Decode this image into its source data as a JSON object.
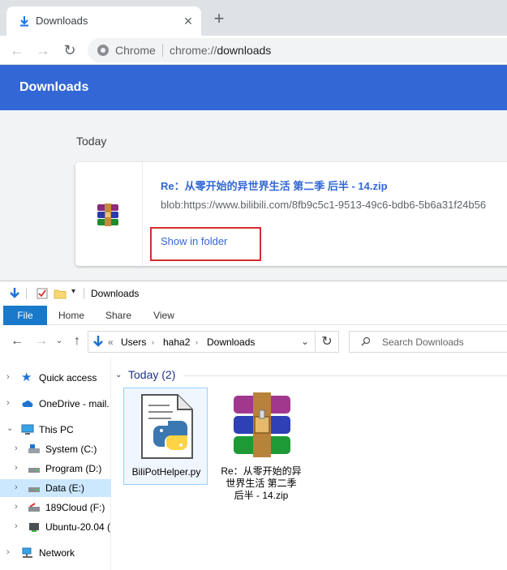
{
  "browser": {
    "tab_title": "Downloads",
    "tab_close": "×",
    "new_tab": "+",
    "omnibox_label": "Chrome",
    "url_dim": "chrome://",
    "url_main": "downloads",
    "back_icon": "←",
    "forward_icon": "→",
    "reload_icon": "↻"
  },
  "downloads_page": {
    "header_title": "Downloads",
    "section": "Today",
    "item": {
      "filename": "Re：从零开始的异世界生活 第二季 后半 - 14.zip",
      "url": "blob:https://www.bilibili.com/8fb9c5c1-9513-49c6-bdb6-5b6a31f24b56",
      "action": "Show in folder"
    },
    "colors": {
      "accent": "#3367d6",
      "highlight": "#d32f2f"
    }
  },
  "explorer": {
    "title": "Downloads",
    "ribbon_tabs": [
      "File",
      "Home",
      "Share",
      "View"
    ],
    "breadcrumb": {
      "prefix": "«",
      "items": [
        "Users",
        "haha2",
        "Downloads"
      ]
    },
    "search_placeholder": "Search Downloads",
    "nav": {
      "quick_access": "Quick access",
      "onedrive": "OneDrive - mail.",
      "this_pc": "This PC",
      "system": "System (C:)",
      "program": "Program (D:)",
      "data": "Data (E:)",
      "cloud": "189Cloud (F:)",
      "ubuntu": "Ubuntu-20.04 (",
      "network": "Network"
    },
    "group_header": "Today (2)",
    "files": [
      {
        "name": "BiliPotHelper.py",
        "icon": "python-file-icon"
      },
      {
        "name": "Re：从零开始的异世界生活 第二季 后半 - 14.zip",
        "icon": "winrar-archive-icon"
      }
    ]
  }
}
